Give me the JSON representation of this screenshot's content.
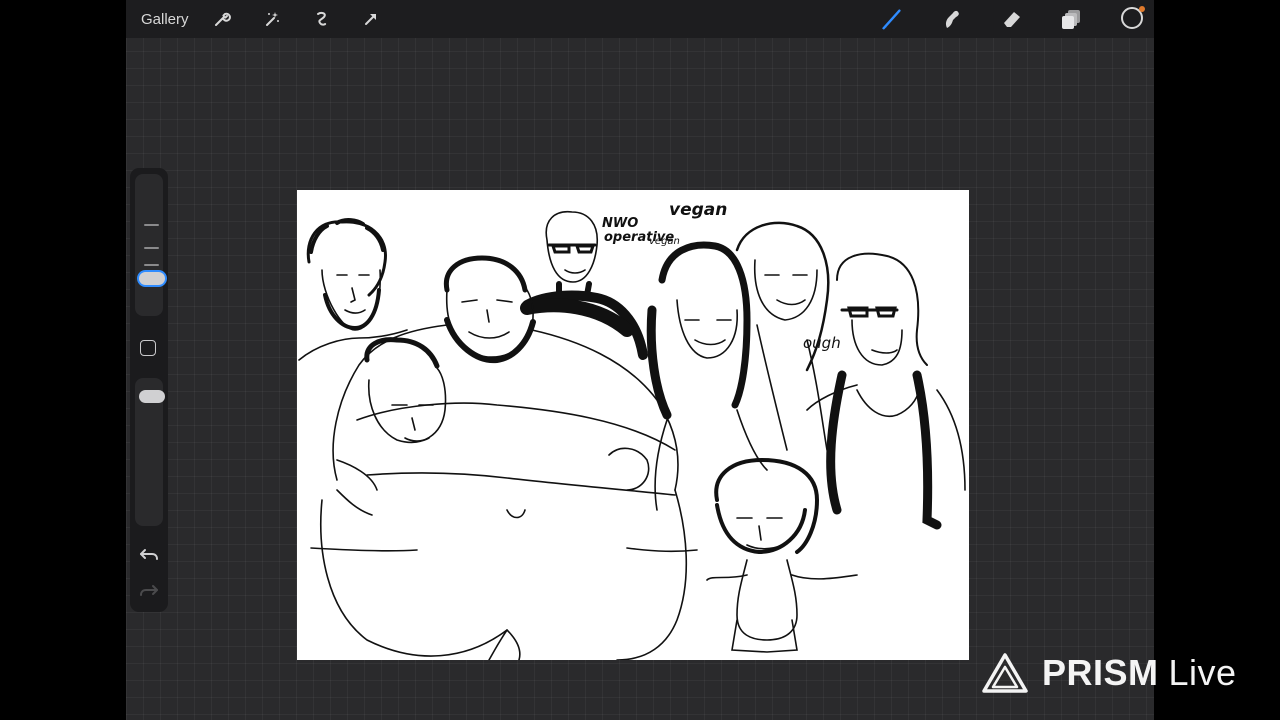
{
  "topbar": {
    "gallery_label": "Gallery",
    "left_tools": [
      "wrench-icon",
      "magic-wand-icon",
      "selection-icon",
      "transform-arrow-icon"
    ],
    "right_tools": [
      "brush-icon",
      "smudge-icon",
      "eraser-icon",
      "layers-icon"
    ],
    "active_tool": "brush-icon",
    "accent_color": "#2f8cff",
    "current_color": "#000000"
  },
  "sidebar": {
    "brush_size": 0.3,
    "opacity": 1.0,
    "icons": [
      "modify-square-icon",
      "undo-icon",
      "redo-icon"
    ]
  },
  "canvas": {
    "handwritten_notes": {
      "nwo": "NWO",
      "operative": "operative",
      "vegan_small": "vegan",
      "vegan_large": "vegan",
      "ough": "ough"
    }
  },
  "watermark": {
    "brand": "PRISM",
    "suffix": "Live"
  }
}
